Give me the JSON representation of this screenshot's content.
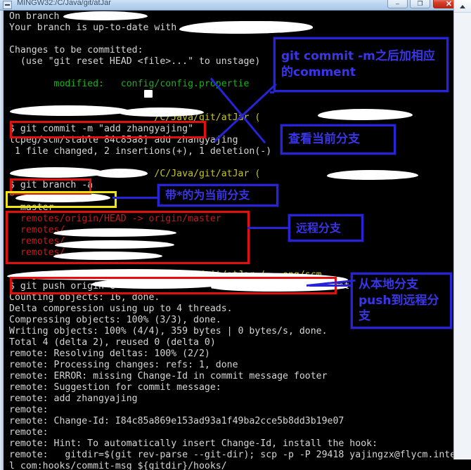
{
  "window": {
    "title": "MINGW32:/C/Java/git/atJar",
    "minimize_label": "–",
    "maximize_label": "❐",
    "close_label": "✕"
  },
  "terminal": {
    "lines": [
      {
        "id": "l1",
        "text": "On branch ",
        "color": "white"
      },
      {
        "id": "l2",
        "text": "Your branch is up-to-date with ",
        "color": "white"
      },
      {
        "id": "l3",
        "text": "",
        "color": "white"
      },
      {
        "id": "l4",
        "text": "Changes to be committed:",
        "color": "white"
      },
      {
        "id": "l5",
        "text": "  (use \"git reset HEAD <file>...\" to unstage)",
        "color": "white"
      },
      {
        "id": "l6",
        "text": "",
        "color": "white"
      },
      {
        "id": "l7",
        "text": "        modified:   config/config.propertie",
        "color": "green"
      },
      {
        "id": "l8",
        "text": "",
        "color": "white"
      },
      {
        "id": "l9",
        "text": "",
        "color": "white"
      },
      {
        "id": "l10",
        "text": "                          /C/Java/git/atJar (",
        "color": "yellow"
      },
      {
        "id": "l11",
        "text": "$ git commit -m \"add zhangyajing\"",
        "color": "white"
      },
      {
        "id": "l12",
        "text": "lcpeg/scm/stable 84c85a8] add zhangyajing",
        "color": "white"
      },
      {
        "id": "l13",
        "text": " 1 file changed, 2 insertions(+), 1 deletion(-)",
        "color": "white"
      },
      {
        "id": "l14",
        "text": "",
        "color": "white"
      },
      {
        "id": "l15",
        "text": "                          /C/Java/git/atJar (",
        "color": "yellow"
      },
      {
        "id": "l16",
        "text": "$ git branch -a",
        "color": "white"
      },
      {
        "id": "l17",
        "text": "*",
        "color": "white"
      },
      {
        "id": "l18",
        "text": "  master",
        "color": "white"
      },
      {
        "id": "l19",
        "text": "  remotes/origin/HEAD -> origin/master",
        "color": "red"
      },
      {
        "id": "l20",
        "text": "  remotes/",
        "color": "red"
      },
      {
        "id": "l21",
        "text": "  remotes/",
        "color": "red"
      },
      {
        "id": "l22",
        "text": "  remotes/",
        "color": "red"
      },
      {
        "id": "l23",
        "text": "",
        "color": "white"
      },
      {
        "id": "l24",
        "text": "   ngzx@                   /C/Java/git/atJar (   eng/scm",
        "color": "yellow"
      },
      {
        "id": "l25",
        "text": "$ git push origin c                 ref/for/             test",
        "color": "white"
      },
      {
        "id": "l26",
        "text": "Counting objects: 16, done.",
        "color": "white"
      },
      {
        "id": "l27",
        "text": "Delta compression using up to 4 threads.",
        "color": "white"
      },
      {
        "id": "l28",
        "text": "Compressing objects: 100% (3/3), done.",
        "color": "white"
      },
      {
        "id": "l29",
        "text": "Writing objects: 100% (4/4), 359 bytes | 0 bytes/s, done.",
        "color": "white"
      },
      {
        "id": "l30",
        "text": "Total 4 (delta 2), reused 0 (delta 0)",
        "color": "white"
      },
      {
        "id": "l31",
        "text": "remote: Resolving deltas: 100% (2/2)",
        "color": "white"
      },
      {
        "id": "l32",
        "text": "remote: Processing changes: refs: 1, done",
        "color": "white"
      },
      {
        "id": "l33",
        "text": "remote: ERROR: missing Change-Id in commit message footer",
        "color": "white"
      },
      {
        "id": "l34",
        "text": "remote: Suggestion for commit message:",
        "color": "white"
      },
      {
        "id": "l35",
        "text": "remote: add zhangyajing",
        "color": "white"
      },
      {
        "id": "l36",
        "text": "remote:",
        "color": "white"
      },
      {
        "id": "l37",
        "text": "remote: Change-Id: I84c85a869e153ad93a1f49ba2cce5b8dd3b19e07",
        "color": "white"
      },
      {
        "id": "l38",
        "text": "remote:",
        "color": "white"
      },
      {
        "id": "l39",
        "text": "remote: Hint: To automatically insert Change-Id, install the hook:",
        "color": "white"
      },
      {
        "id": "l40",
        "text": "remote:   gitdir=$(git rev-parse --git-dir); scp -p -P 29418 yajingzx@flycm.inte",
        "color": "white"
      },
      {
        "id": "l41",
        "text": "l com:hooks/commit-msg ${gitdir}/hooks/",
        "color": "white"
      }
    ]
  },
  "annotations": {
    "commit_note": "git commit -m之后加相应的comment",
    "branch_note": "查看当前分支",
    "current_branch_note": "带*的为当前分支",
    "remote_branch_note": "远程分支",
    "push_note": "从本地分支push到远程分支"
  },
  "colors": {
    "highlight_red": "#e20f0f",
    "highlight_yellow": "#f2e70d",
    "annotation_blue": "#2723d6",
    "terminal_bg": "#000000",
    "terminal_fg": "#d6d6d6",
    "git_green": "#15b415",
    "git_red": "#c21b1b",
    "prompt_yellow": "#c7c71d"
  }
}
